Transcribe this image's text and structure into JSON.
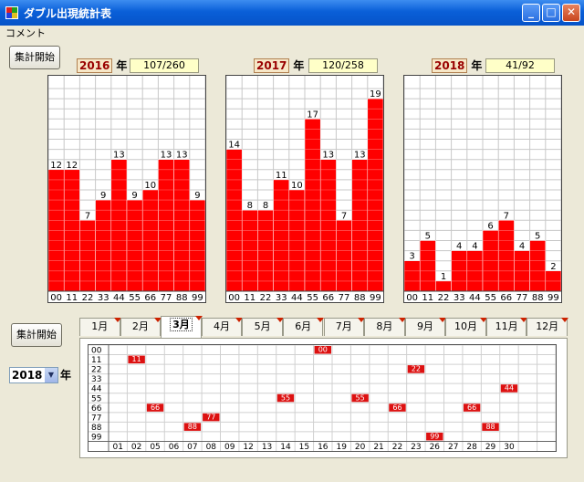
{
  "window": {
    "title": "ダブル出現統計表"
  },
  "menu": {
    "items": [
      "コメント"
    ]
  },
  "buttons": {
    "start_top": "集計開始",
    "start_bottom": "集計開始"
  },
  "charts": [
    {
      "year": "2016",
      "suffix": "年",
      "ratio": "107/260"
    },
    {
      "year": "2017",
      "suffix": "年",
      "ratio": "120/258"
    },
    {
      "year": "2018",
      "suffix": "年",
      "ratio": "41/92"
    }
  ],
  "chart_data": [
    {
      "type": "bar",
      "categories": [
        "00",
        "11",
        "22",
        "33",
        "44",
        "55",
        "66",
        "77",
        "88",
        "99"
      ],
      "values": [
        12,
        12,
        7,
        9,
        13,
        9,
        10,
        13,
        13,
        9
      ],
      "ylim": [
        0,
        20
      ]
    },
    {
      "type": "bar",
      "categories": [
        "00",
        "11",
        "22",
        "33",
        "44",
        "55",
        "66",
        "77",
        "88",
        "99"
      ],
      "values": [
        14,
        8,
        8,
        11,
        10,
        17,
        13,
        7,
        13,
        19
      ],
      "ylim": [
        0,
        20
      ]
    },
    {
      "type": "bar",
      "categories": [
        "00",
        "11",
        "22",
        "33",
        "44",
        "55",
        "66",
        "77",
        "88",
        "99"
      ],
      "values": [
        3,
        5,
        1,
        4,
        4,
        6,
        7,
        4,
        5,
        2
      ],
      "ylim": [
        0,
        20
      ]
    }
  ],
  "year_select": {
    "value": "2018",
    "suffix": "年"
  },
  "tabs": [
    "1月",
    "2月",
    "3月",
    "4月",
    "5月",
    "6月",
    "7月",
    "8月",
    "9月",
    "10月",
    "11月",
    "12月"
  ],
  "active_tab": 2,
  "table": {
    "rows": [
      "00",
      "11",
      "22",
      "33",
      "44",
      "55",
      "66",
      "77",
      "88",
      "99"
    ],
    "days": [
      "01",
      "02",
      "05",
      "06",
      "07",
      "08",
      "09",
      "12",
      "13",
      "14",
      "15",
      "16",
      "19",
      "20",
      "21",
      "22",
      "23",
      "26",
      "27",
      "28",
      "29",
      "30"
    ],
    "marks": [
      {
        "row": "00",
        "day": "16"
      },
      {
        "row": "11",
        "day": "02"
      },
      {
        "row": "22",
        "day": "23"
      },
      {
        "row": "44",
        "day": "30"
      },
      {
        "row": "55",
        "day": "14"
      },
      {
        "row": "55",
        "day": "20"
      },
      {
        "row": "66",
        "day": "05"
      },
      {
        "row": "66",
        "day": "22"
      },
      {
        "row": "66",
        "day": "28"
      },
      {
        "row": "77",
        "day": "08"
      },
      {
        "row": "88",
        "day": "07"
      },
      {
        "row": "88",
        "day": "29"
      },
      {
        "row": "99",
        "day": "26"
      }
    ]
  },
  "colors": {
    "bar": "#ff0000",
    "mark": "#dd1111",
    "grid": "#c8c8c8",
    "titlebar": "#0a5fd8"
  },
  "icons": [
    "app-icon",
    "minimize-icon",
    "maximize-icon",
    "close-icon",
    "dropdown-arrow-icon"
  ]
}
